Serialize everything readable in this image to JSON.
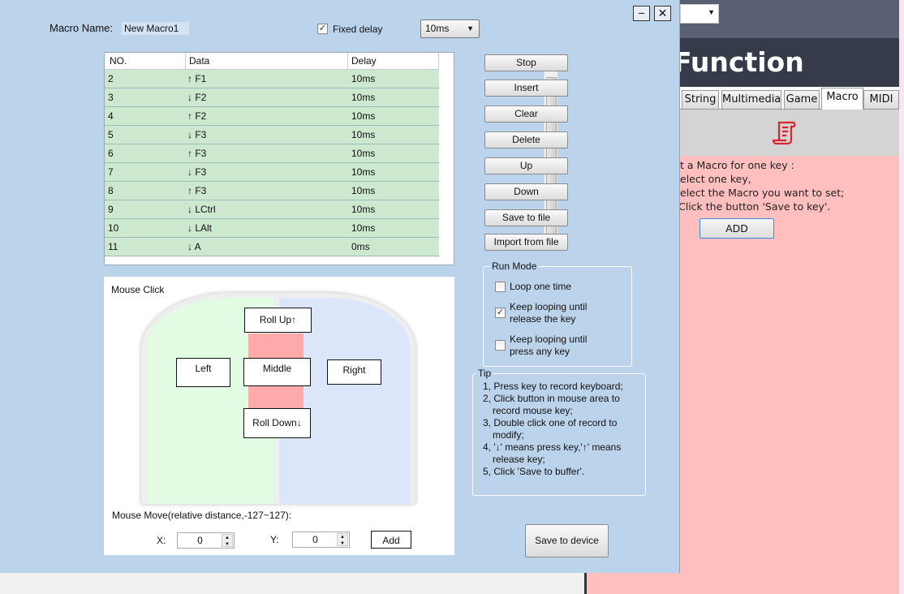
{
  "background_app": {
    "title": "Function",
    "tabs": [
      {
        "label": "String"
      },
      {
        "label": "Multimedia"
      },
      {
        "label": "Game"
      },
      {
        "label": "Macro",
        "active": true
      },
      {
        "label": "MIDI"
      }
    ],
    "icon": "macro-scroll-icon",
    "instructions": [
      "t a Macro for one key :",
      "elect one key,",
      "elect the Macro you want to set;",
      "Click the button 'Save to key'."
    ],
    "add_label": "ADD"
  },
  "dialog": {
    "minimize": "−",
    "close": "✕",
    "macro_name_label": "Macro Name:",
    "macro_name_value": "New Macro1",
    "fixed_delay_label": "Fixed delay",
    "fixed_delay_checked": true,
    "delay_select": "10ms",
    "table": {
      "headers": [
        "NO.",
        "Data",
        "Delay"
      ],
      "rows": [
        {
          "no": "2",
          "data": "↑ F1",
          "delay": "10ms"
        },
        {
          "no": "3",
          "data": "↓ F2",
          "delay": "10ms"
        },
        {
          "no": "4",
          "data": "↑ F2",
          "delay": "10ms"
        },
        {
          "no": "5",
          "data": "↓ F3",
          "delay": "10ms"
        },
        {
          "no": "6",
          "data": "↑ F3",
          "delay": "10ms"
        },
        {
          "no": "7",
          "data": "↓ F3",
          "delay": "10ms"
        },
        {
          "no": "8",
          "data": "↑ F3",
          "delay": "10ms"
        },
        {
          "no": "9",
          "data": "↓ LCtrl",
          "delay": "10ms"
        },
        {
          "no": "10",
          "data": "↓ LAlt",
          "delay": "10ms"
        },
        {
          "no": "11",
          "data": "↓ A",
          "delay": "0ms"
        }
      ]
    },
    "buttons": [
      "Stop",
      "Insert",
      "Clear",
      "Delete",
      "Up",
      "Down",
      "Save to file",
      "Import from file"
    ],
    "mouse": {
      "title": "Mouse Click",
      "roll_up": "Roll Up↑",
      "left": "Left",
      "middle": "Middle",
      "right": "Right",
      "roll_down": "Roll Down↓",
      "move_label": "Mouse Move(relative distance,-127~127):",
      "x_label": "X:",
      "x_value": "0",
      "y_label": "Y:",
      "y_value": "0",
      "add": "Add"
    },
    "run_mode": {
      "title": "Run Mode",
      "options": [
        {
          "label": "Loop one time",
          "checked": false
        },
        {
          "label": "Keep looping until release the key",
          "checked": true
        },
        {
          "label": "Keep looping until press any key",
          "checked": false
        }
      ]
    },
    "tip": {
      "title": "Tip",
      "lines": [
        "1,  Press key to record keyboard;",
        "2,  Click button in mouse area to",
        "record mouse key;",
        "3,  Double click one of record to",
        "modify;",
        "4,  '↓' means press key,'↑'  means",
        "release key;",
        "5,  Click 'Save to buffer'."
      ]
    },
    "save_device": "Save to device"
  }
}
